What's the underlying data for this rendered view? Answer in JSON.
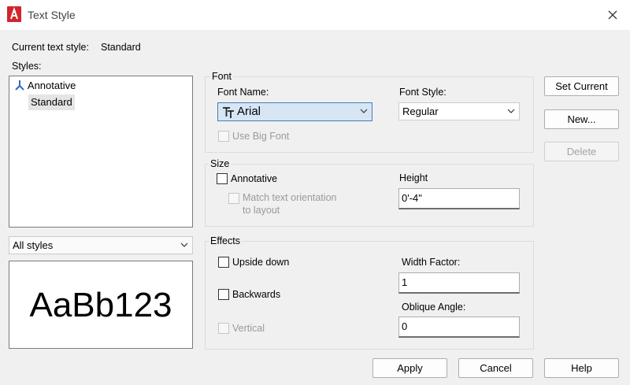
{
  "window": {
    "title": "Text Style"
  },
  "current_style": {
    "label": "Current text style:",
    "value": "Standard"
  },
  "styles": {
    "label": "Styles:",
    "items": [
      {
        "label": "Annotative",
        "icon": "annotative-icon"
      },
      {
        "label": "Standard",
        "selected": true
      }
    ],
    "filter": {
      "value": "All styles"
    }
  },
  "preview": {
    "text": "AaBb123"
  },
  "font": {
    "group_title": "Font",
    "name_label": "Font Name:",
    "name_value": "Arial",
    "name_icon": "truetype-font-icon",
    "style_label": "Font Style:",
    "style_value": "Regular",
    "big_font_label": "Use Big Font"
  },
  "size": {
    "group_title": "Size",
    "annotative_label": "Annotative",
    "match_label_1": "Match text orientation",
    "match_label_2": "to layout",
    "height_label": "Height",
    "height_value": "0'-4\""
  },
  "effects": {
    "group_title": "Effects",
    "upside_down_label": "Upside down",
    "backwards_label": "Backwards",
    "vertical_label": "Vertical",
    "width_factor_label": "Width Factor:",
    "width_factor_value": "1",
    "oblique_label": "Oblique Angle:",
    "oblique_value": "0"
  },
  "buttons": {
    "set_current": "Set Current",
    "new": "New...",
    "delete": "Delete",
    "apply": "Apply",
    "cancel": "Cancel",
    "help": "Help"
  },
  "colors": {
    "accent": "#4a7cb7",
    "app_icon": "#d0262d",
    "annotative_icon": "#2c6bc9"
  }
}
